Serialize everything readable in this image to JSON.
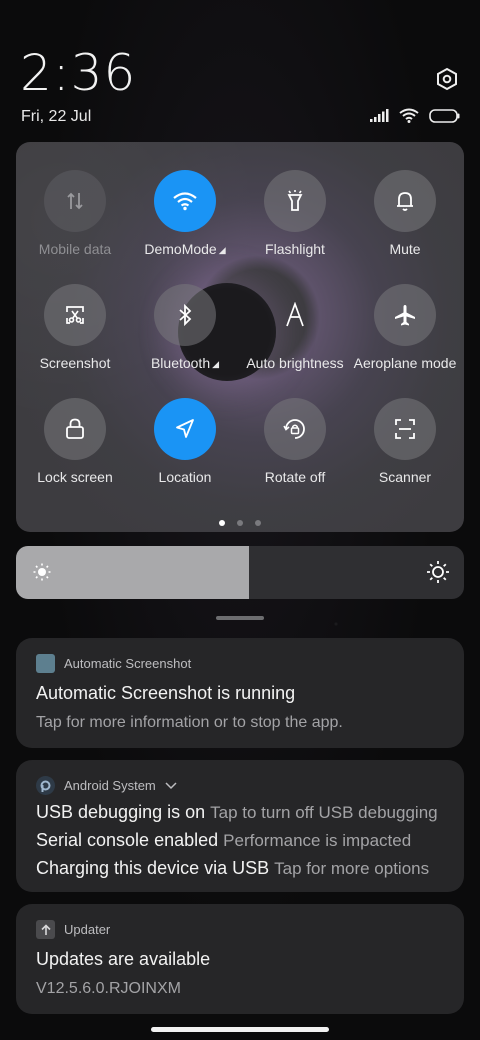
{
  "status": {
    "time": "2:36",
    "date": "Fri, 22 Jul"
  },
  "icons": {
    "settings": "settings-hexagon-icon",
    "signal": "signal-icon",
    "wifi": "wifi-icon",
    "battery": "battery-icon"
  },
  "quick_settings": {
    "tiles": [
      {
        "label": "Mobile data",
        "icon": "mobile-data-icon",
        "state": "disabled"
      },
      {
        "label": "DemoMode",
        "icon": "wifi-icon",
        "state": "active",
        "has_arrow": true
      },
      {
        "label": "Flashlight",
        "icon": "flashlight-icon",
        "state": "off"
      },
      {
        "label": "Mute",
        "icon": "bell-icon",
        "state": "off"
      },
      {
        "label": "Screenshot",
        "icon": "screenshot-icon",
        "state": "off"
      },
      {
        "label": "Bluetooth",
        "icon": "bluetooth-icon",
        "state": "off",
        "has_arrow": true
      },
      {
        "label": "Auto brightness",
        "icon": "auto-brightness-icon",
        "state": "off"
      },
      {
        "label": "Aeroplane mode",
        "icon": "aeroplane-icon",
        "state": "off"
      },
      {
        "label": "Lock screen",
        "icon": "lock-icon",
        "state": "off"
      },
      {
        "label": "Location",
        "icon": "location-icon",
        "state": "active"
      },
      {
        "label": "Rotate off",
        "icon": "rotate-lock-icon",
        "state": "off"
      },
      {
        "label": "Scanner",
        "icon": "scanner-icon",
        "state": "off"
      }
    ],
    "pages": 3,
    "current_page": 1
  },
  "brightness": {
    "level_percent": 52
  },
  "notifications": [
    {
      "app": "Automatic Screenshot",
      "title": "Automatic Screenshot is running",
      "body": "Tap for more information or to stop the app."
    },
    {
      "app": "Android System",
      "lines": [
        {
          "strong": "USB debugging is on",
          "weak": "Tap to turn off USB debugging"
        },
        {
          "strong": "Serial console enabled",
          "weak": "Performance is impacted"
        },
        {
          "strong": "Charging this device via USB",
          "weak": "Tap for more options"
        }
      ]
    },
    {
      "app": "Updater",
      "title": "Updates are available",
      "body": "V12.5.6.0.RJOINXM"
    }
  ]
}
